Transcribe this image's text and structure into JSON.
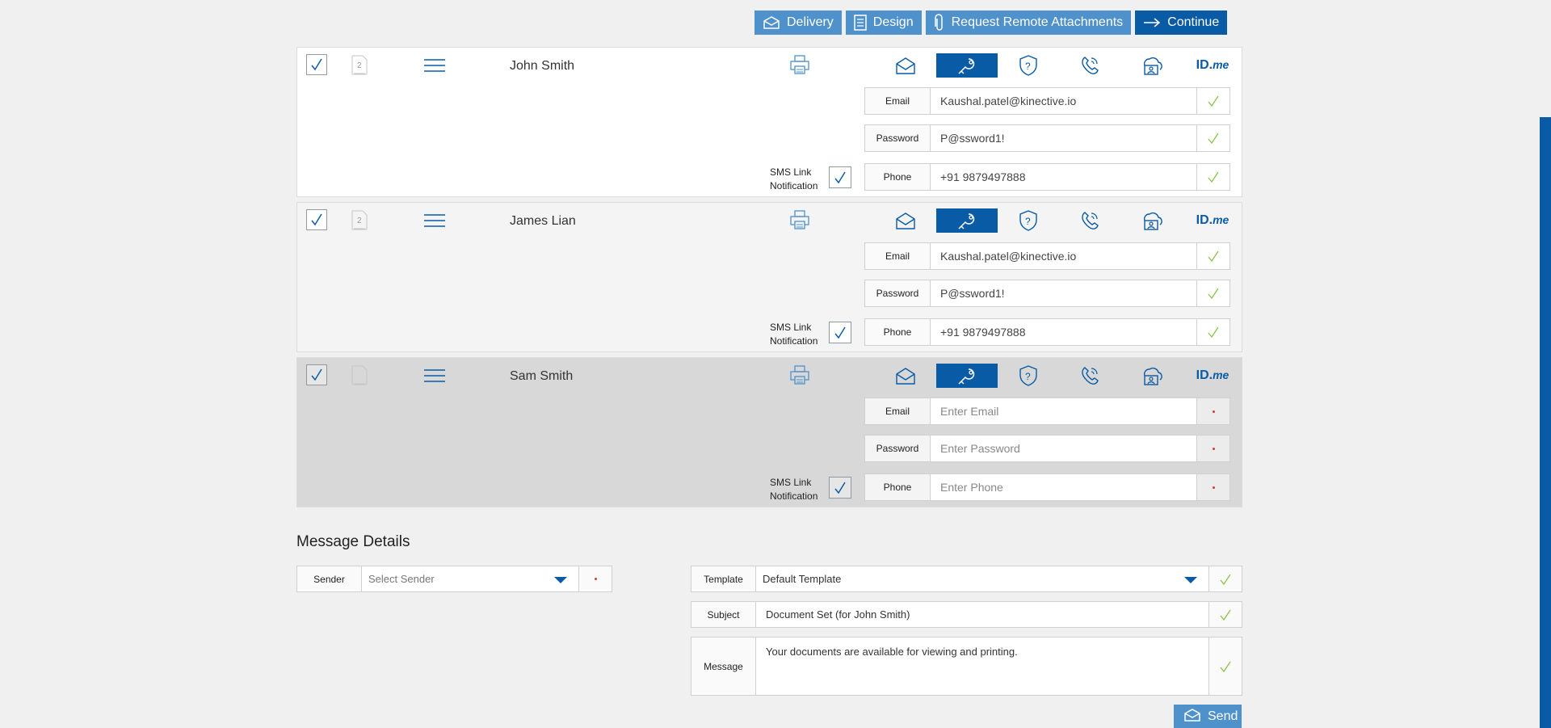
{
  "toolbar": {
    "delivery": "Delivery",
    "design": "Design",
    "remote": "Request Remote Attachments",
    "continue": "Continue"
  },
  "recipients": [
    {
      "name": "John Smith",
      "email_label": "Email",
      "email": "Kaushal.patel@kinective.io",
      "email_placeholder": "",
      "password_label": "Password",
      "password": "P@ssword1!",
      "password_placeholder": "",
      "phone_label": "Phone",
      "phone": "+91 9879497888",
      "phone_placeholder": "",
      "sms_line1": "SMS Link",
      "sms_line2": "Notification",
      "status": "valid",
      "doc_count": "2"
    },
    {
      "name": "James Lian",
      "email_label": "Email",
      "email": "Kaushal.patel@kinective.io",
      "email_placeholder": "",
      "password_label": "Password",
      "password": "P@ssword1!",
      "password_placeholder": "",
      "phone_label": "Phone",
      "phone": "+91 9879497888",
      "phone_placeholder": "",
      "sms_line1": "SMS Link",
      "sms_line2": "Notification",
      "status": "valid",
      "doc_count": "2"
    },
    {
      "name": "Sam Smith",
      "email_label": "Email",
      "email": "",
      "email_placeholder": "Enter Email",
      "password_label": "Password",
      "password": "",
      "password_placeholder": "Enter Password",
      "phone_label": "Phone",
      "phone": "",
      "phone_placeholder": "Enter Phone",
      "sms_line1": "SMS Link",
      "sms_line2": "Notification",
      "status": "required",
      "doc_count": ""
    }
  ],
  "auth_icons": [
    "email-auth-icon",
    "key-auth-icon",
    "question-auth-icon",
    "phone-auth-icon",
    "cloud-person-auth-icon",
    "idme-auth-icon"
  ],
  "idme": {
    "main": "ID.",
    "sub": "me"
  },
  "message": {
    "title": "Message Details",
    "sender_label": "Sender",
    "sender_placeholder": "Select Sender",
    "template_label": "Template",
    "template_value": "Default Template",
    "subject_label": "Subject",
    "subject_value": "Document Set (for John Smith)",
    "message_label": "Message",
    "message_value": "Your documents are available for viewing and printing.",
    "send_label": "Send"
  },
  "colors": {
    "accent": "#0a5ba6",
    "accent_light": "#4e91cb",
    "check": "#8bc34a",
    "required": "#d43a3a"
  }
}
